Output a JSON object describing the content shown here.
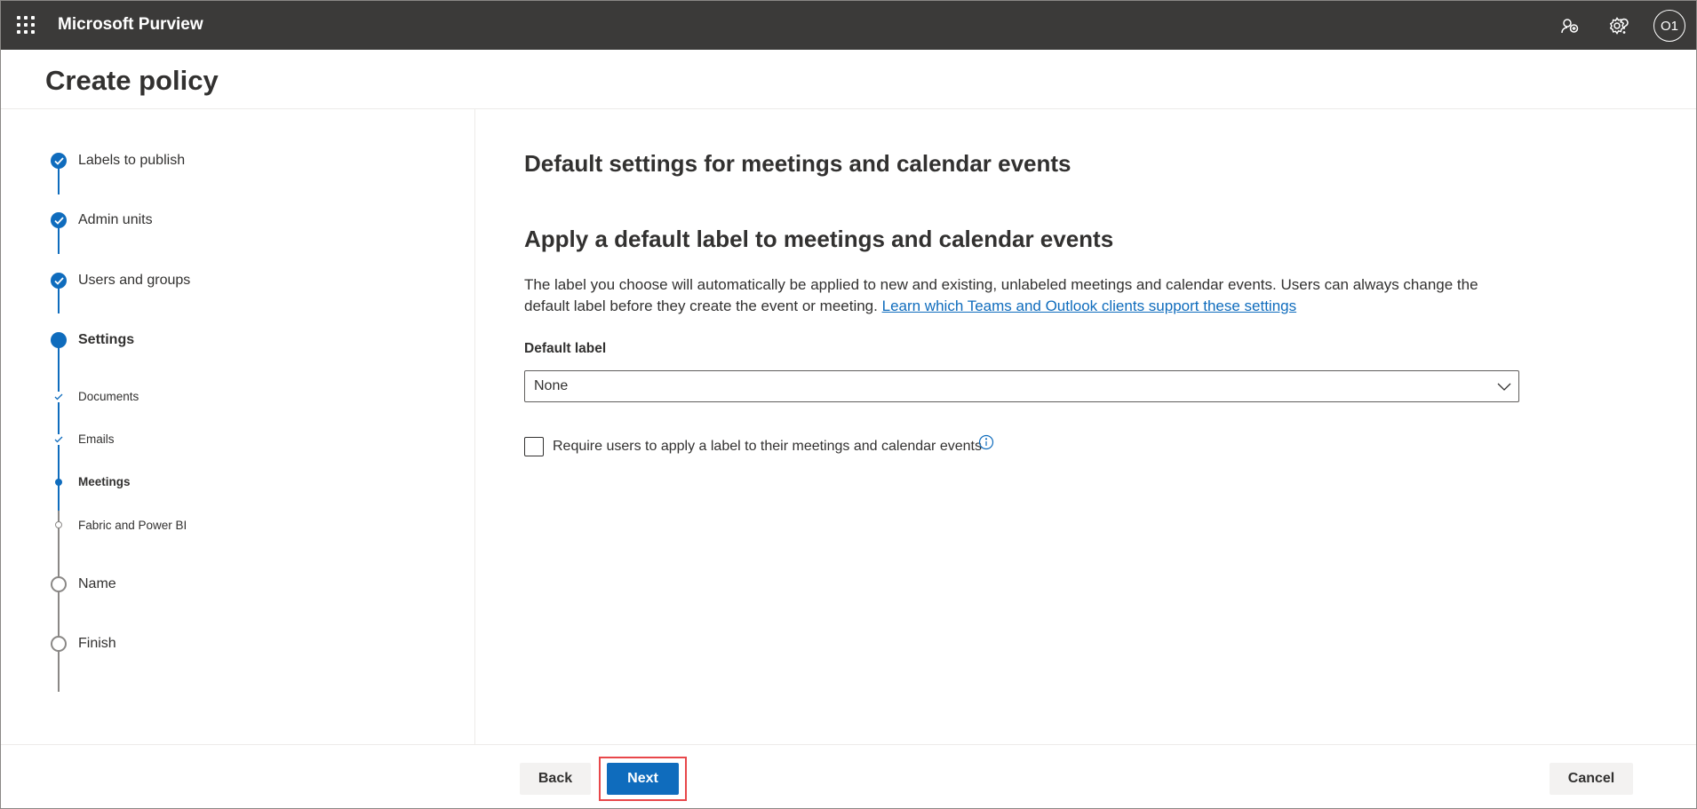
{
  "app": {
    "title": "Microsoft Purview",
    "avatar_initials": "O1"
  },
  "page": {
    "title": "Create policy"
  },
  "wizard": {
    "steps": [
      {
        "label": "Labels to publish",
        "state": "completed"
      },
      {
        "label": "Admin units",
        "state": "completed"
      },
      {
        "label": "Users and groups",
        "state": "completed"
      },
      {
        "label": "Settings",
        "state": "current"
      },
      {
        "label": "Documents",
        "state": "completed",
        "substep": true
      },
      {
        "label": "Emails",
        "state": "completed",
        "substep": true
      },
      {
        "label": "Meetings",
        "state": "current",
        "substep": true
      },
      {
        "label": "Fabric and Power BI",
        "state": "not-started",
        "substep": true
      },
      {
        "label": "Name",
        "state": "not-started"
      },
      {
        "label": "Finish",
        "state": "not-started"
      }
    ]
  },
  "main": {
    "section_heading": "Default settings for meetings and calendar events",
    "sub_heading": "Apply a default label to meetings and calendar events",
    "description": "The label you choose will automatically be applied to new and existing, unlabeled meetings and calendar events. Users can always change the default label before they create the event or meeting.",
    "learn_more_link": "Learn which Teams and Outlook clients support these settings",
    "default_label": {
      "label": "Default label",
      "value": "None"
    },
    "require_label": {
      "label": "Require users to apply a label to their meetings and calendar events",
      "checked": false
    }
  },
  "footer": {
    "back_label": "Back",
    "next_label": "Next",
    "cancel_label": "Cancel"
  },
  "colors": {
    "accent": "#0f6cbd",
    "topbar": "#3b3a39",
    "highlight": "#e8474a"
  },
  "icons": [
    "waffle-icon",
    "feedback-icon",
    "gear-icon",
    "help-icon",
    "info-icon",
    "chevron-down-icon",
    "checkmark-icon"
  ]
}
